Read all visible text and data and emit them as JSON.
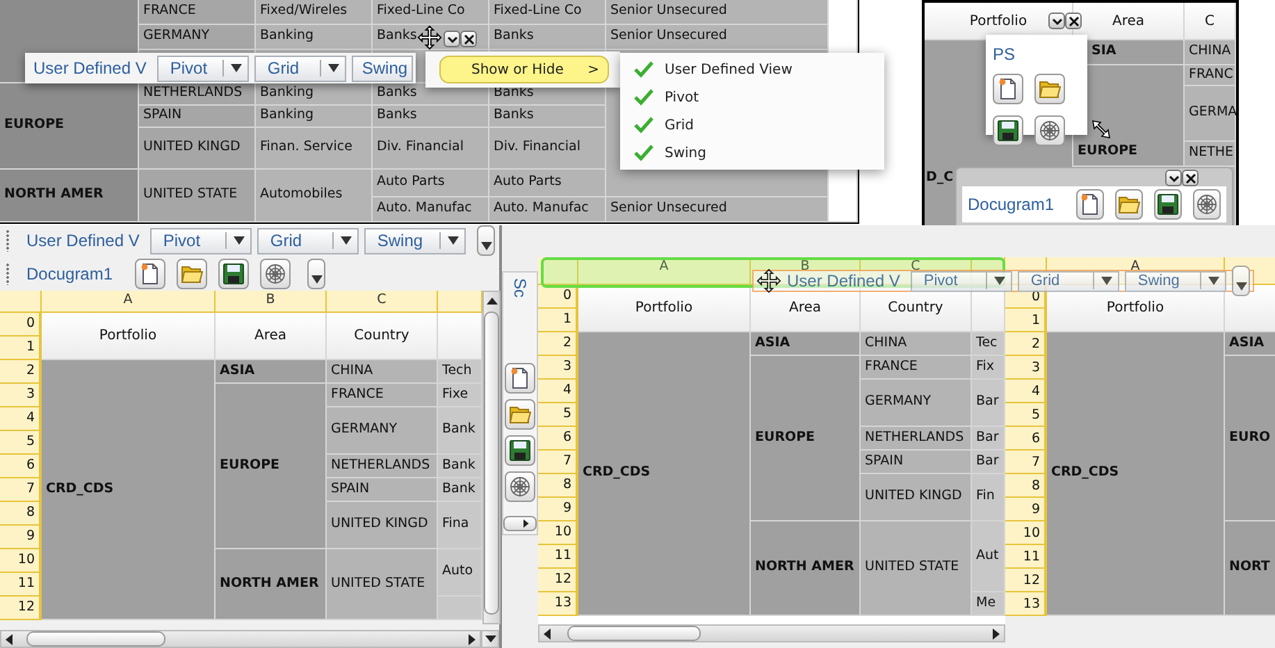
{
  "top_left_view": {
    "grid_cells": [
      {
        "text": "EUROPE",
        "kind": "group"
      },
      {
        "text": "NORTH AMER",
        "kind": "group"
      },
      {
        "text": "FRANCE",
        "kind": "item"
      },
      {
        "text": "GERMANY",
        "kind": "item"
      },
      {
        "text": "NETHERLANDS",
        "kind": "item"
      },
      {
        "text": "SPAIN",
        "kind": "item"
      },
      {
        "text": "UNITED KINGD",
        "kind": "item"
      },
      {
        "text": "UNITED STATE",
        "kind": "item"
      },
      {
        "text": "Fixed/Wireles",
        "kind": "detail"
      },
      {
        "text": "Banking",
        "kind": "detail"
      },
      {
        "text": "Banking",
        "kind": "detail"
      },
      {
        "text": "Banking",
        "kind": "detail"
      },
      {
        "text": "Finan. Service",
        "kind": "detail"
      },
      {
        "text": "Automobiles",
        "kind": "detail"
      },
      {
        "text": "Fixed-Line Co",
        "kind": "detail"
      },
      {
        "text": "Banks",
        "kind": "detail"
      },
      {
        "text": "Banks",
        "kind": "detail"
      },
      {
        "text": "Banks",
        "kind": "detail"
      },
      {
        "text": "Div. Financial",
        "kind": "detail"
      },
      {
        "text": "Auto Parts",
        "kind": "detail"
      },
      {
        "text": "Auto. Manufac",
        "kind": "detail"
      },
      {
        "text": "Fixed-Line Co",
        "kind": "detail"
      },
      {
        "text": "Banks",
        "kind": "detail"
      },
      {
        "text": "Banks",
        "kind": "detail"
      },
      {
        "text": "Banks",
        "kind": "detail"
      },
      {
        "text": "Div. Financial",
        "kind": "detail"
      },
      {
        "text": "Auto Parts",
        "kind": "detail"
      },
      {
        "text": "Auto. Manufac",
        "kind": "detail"
      },
      {
        "text": "Senior Unsecured",
        "kind": "detail"
      },
      {
        "text": "Senior Unsecured",
        "kind": "detail"
      },
      {
        "text": "Senior Unsecured",
        "kind": "detail"
      }
    ],
    "floating_toolbar": {
      "label": "User Defined V",
      "dropdowns": [
        "Pivot",
        "Grid",
        "Swing"
      ]
    },
    "context_menu": {
      "item": "Show or Hide",
      "arrow": ">"
    },
    "submenu": [
      {
        "label": "User Defined View",
        "checked": true
      },
      {
        "label": "Pivot",
        "checked": true
      },
      {
        "label": "Grid",
        "checked": true
      },
      {
        "label": "Swing",
        "checked": true
      }
    ]
  },
  "top_right_view": {
    "headers": [
      "Portfolio",
      "Area",
      "C"
    ],
    "grid_cells": [
      {
        "text": "D_C",
        "kind": "group"
      },
      {
        "text": "SIA",
        "kind": "group"
      },
      {
        "text": "EUROPE",
        "kind": "group"
      },
      {
        "text": "CHINA",
        "kind": "item"
      },
      {
        "text": "FRANC",
        "kind": "item"
      },
      {
        "text": "GERMA",
        "kind": "item"
      },
      {
        "text": "NETHE",
        "kind": "item"
      }
    ],
    "palette": {
      "title": "PS"
    },
    "floating_toolbar": {
      "title": "Docugram1"
    }
  },
  "bottom_left_view": {
    "toolbars": [
      {
        "kind": "dropdowns",
        "label": "User Defined V",
        "dropdowns": [
          "Pivot",
          "Grid",
          "Swing"
        ]
      },
      {
        "kind": "actions",
        "label": "Docugram1"
      }
    ],
    "grid": {
      "column_letters": [
        "A",
        "B",
        "C"
      ],
      "row_numbers": [
        "0",
        "1",
        "2",
        "3",
        "4",
        "5",
        "6",
        "7",
        "8",
        "9",
        "10",
        "11",
        "12"
      ],
      "headers": [
        "Portfolio",
        "Area",
        "Country"
      ],
      "cells": [
        {
          "text": "CRD_CDS",
          "kind": "group"
        },
        {
          "text": "ASIA",
          "kind": "group"
        },
        {
          "text": "EUROPE",
          "kind": "group"
        },
        {
          "text": "NORTH AMER",
          "kind": "group"
        },
        {
          "text": "CHINA",
          "kind": "item"
        },
        {
          "text": "FRANCE",
          "kind": "item"
        },
        {
          "text": "GERMANY",
          "kind": "item"
        },
        {
          "text": "NETHERLANDS",
          "kind": "item"
        },
        {
          "text": "SPAIN",
          "kind": "item"
        },
        {
          "text": "UNITED KINGD",
          "kind": "item"
        },
        {
          "text": "UNITED STATE",
          "kind": "item"
        },
        {
          "text": "Tech",
          "kind": "detail"
        },
        {
          "text": "Fixe",
          "kind": "detail"
        },
        {
          "text": "Bank",
          "kind": "detail"
        },
        {
          "text": "Bank",
          "kind": "detail"
        },
        {
          "text": "Bank",
          "kind": "detail"
        },
        {
          "text": "Fina",
          "kind": "detail"
        },
        {
          "text": "Auto",
          "kind": "detail"
        }
      ]
    }
  },
  "bottom_right_view": {
    "side_toolbar": {
      "label": "Sc"
    },
    "dragged_toolbar": {
      "label": "User Defined V",
      "dropdowns": [
        "Pivot",
        "Grid",
        "Swing"
      ]
    },
    "left_grid": {
      "column_letters": [
        "A",
        "B",
        "C"
      ],
      "row_numbers": [
        "0",
        "1",
        "2",
        "3",
        "4",
        "5",
        "6",
        "7",
        "8",
        "9",
        "10",
        "11",
        "12",
        "13"
      ],
      "headers": [
        "Portfolio",
        "Area",
        "Country"
      ],
      "cells": [
        {
          "text": "CRD_CDS",
          "kind": "group"
        },
        {
          "text": "ASIA",
          "kind": "group"
        },
        {
          "text": "EUROPE",
          "kind": "group"
        },
        {
          "text": "NORTH AMER",
          "kind": "group"
        },
        {
          "text": "CHINA",
          "kind": "item"
        },
        {
          "text": "FRANCE",
          "kind": "item"
        },
        {
          "text": "GERMANY",
          "kind": "item"
        },
        {
          "text": "NETHERLANDS",
          "kind": "item"
        },
        {
          "text": "SPAIN",
          "kind": "item"
        },
        {
          "text": "UNITED KINGD",
          "kind": "item"
        },
        {
          "text": "UNITED STATE",
          "kind": "item"
        },
        {
          "text": "Tec",
          "kind": "detail"
        },
        {
          "text": "Fix",
          "kind": "detail"
        },
        {
          "text": "Bar",
          "kind": "detail"
        },
        {
          "text": "Bar",
          "kind": "detail"
        },
        {
          "text": "Bar",
          "kind": "detail"
        },
        {
          "text": "Fin",
          "kind": "detail"
        },
        {
          "text": "Aut",
          "kind": "detail"
        },
        {
          "text": "Me",
          "kind": "detail"
        }
      ]
    },
    "right_grid": {
      "column_letters": [
        "A"
      ],
      "row_numbers": [
        "0",
        "1",
        "2",
        "3",
        "4",
        "5",
        "6",
        "7",
        "8",
        "9",
        "10",
        "11",
        "12",
        "13"
      ],
      "headers": [
        "Portfolio"
      ],
      "cells": [
        {
          "text": "CRD_CDS",
          "kind": "group"
        },
        {
          "text": "ASIA",
          "kind": "group"
        },
        {
          "text": "EURO",
          "kind": "group"
        },
        {
          "text": "NORT",
          "kind": "group"
        }
      ]
    }
  }
}
